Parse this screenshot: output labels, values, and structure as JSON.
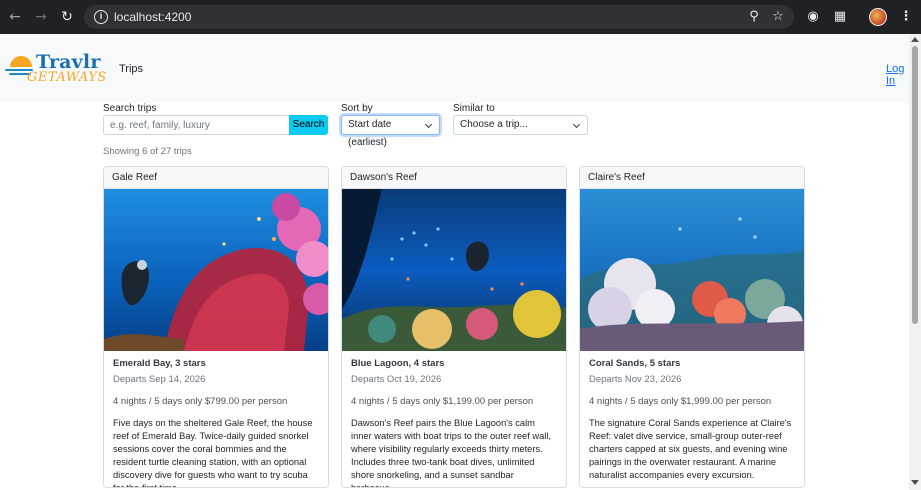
{
  "browser": {
    "url": "localhost:4200",
    "icons": [
      "back-icon",
      "forward-icon",
      "reload-icon",
      "site-info-icon",
      "zoom-icon",
      "bookmark-star-icon",
      "camera-icon",
      "extensions-icon",
      "profile-icon",
      "menu-icon"
    ]
  },
  "header": {
    "logo_title": "Travlr",
    "logo_subtitle": "GETAWAYS",
    "nav_trips": "Trips",
    "login": "Log In"
  },
  "filters": {
    "search_label": "Search trips",
    "search_placeholder": "e.g. reef, family, luxury",
    "search_button": "Search",
    "sort_label": "Sort by",
    "sort_value": "Start date (earliest)",
    "similar_label": "Similar to",
    "similar_value": "Choose a trip...",
    "count_text": "Showing 6 of 27 trips"
  },
  "trips": [
    {
      "name": "Gale Reef",
      "resort": "Emerald Bay, 3 stars",
      "departs": "Departs Sep 14, 2026",
      "price": "4 nights / 5 days only $799.00 per person",
      "description": "Five days on the sheltered Gale Reef, the house reef of Emerald Bay. Twice-daily guided snorkel sessions cover the coral bommies and the resident turtle cleaning station, with an optional discovery dive for guests who want to try scuba for the first time."
    },
    {
      "name": "Dawson's Reef",
      "resort": "Blue Lagoon, 4 stars",
      "departs": "Departs Oct 19, 2026",
      "price": "4 nights / 5 days only $1,199.00 per person",
      "description": "Dawson's Reef pairs the Blue Lagoon's calm inner waters with boat trips to the outer reef wall, where visibility regularly exceeds thirty meters. Includes three two-tank boat dives, unlimited shore snorkeling, and a sunset sandbar barbecue."
    },
    {
      "name": "Claire's Reef",
      "resort": "Coral Sands, 5 stars",
      "departs": "Departs Nov 23, 2026",
      "price": "4 nights / 5 days only $1,999.00 per person",
      "description": "The signature Coral Sands experience at Claire's Reef: valet dive service, small-group outer-reef charters capped at six guests, and evening wine pairings in the overwater restaurant. A marine naturalist accompanies every excursion."
    }
  ],
  "colors": {
    "search_button": "#0dcaf0",
    "link": "#0d6efd",
    "logo_blue": "#1a6fb0",
    "logo_orange": "#f5a623"
  }
}
